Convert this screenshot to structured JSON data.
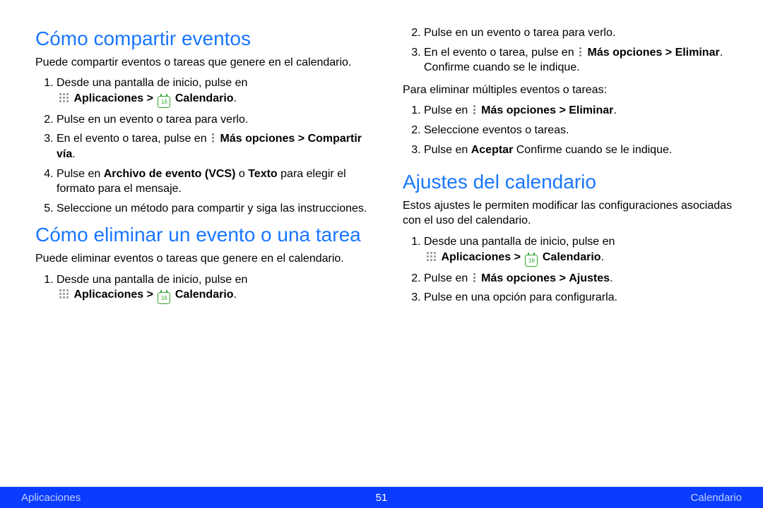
{
  "left": {
    "h1": "Cómo compartir eventos",
    "p1": "Puede compartir eventos o tareas que genere en el calendario.",
    "s1_li1_a": "Desde una pantalla de inicio, pulse en",
    "apps_label": "Aplicaciones",
    "gt": ">",
    "cal_label": "Calendario",
    "cal_day": "16",
    "dot": ".",
    "s1_li2": "Pulse en un evento o tarea para verlo.",
    "s1_li3_a": "En el evento o tarea, pulse en",
    "more_label": "Más opciones",
    "s1_li3_b": "Compartir vía",
    "s1_li4_a": "Pulse en ",
    "s1_li4_b": "Archivo de evento (VCS)",
    "s1_li4_c": " o ",
    "s1_li4_d": "Texto",
    "s1_li4_e": " para elegir el formato para el mensaje.",
    "s1_li5": "Seleccione un método para compartir y siga las instrucciones.",
    "h2": "Cómo eliminar un evento o una tarea",
    "p2": "Puede eliminar eventos o tareas que genere en el calendario.",
    "s2_li1_a": "Desde una pantalla de inicio, pulse en"
  },
  "right": {
    "li2": "Pulse en un evento o tarea para verlo.",
    "li3_a": "En el evento o tarea, pulse en",
    "li3_b": "Eliminar",
    "li3_c": ". Confirme cuando se le indique.",
    "p_multi": "Para eliminar múltiples eventos o tareas:",
    "m_li1_a": "Pulse en",
    "m_li1_b": "Eliminar",
    "m_li2": "Seleccione eventos o tareas.",
    "m_li3_a": "Pulse en ",
    "m_li3_b": "Aceptar",
    "m_li3_c": " Confirme cuando se le indique.",
    "h3": "Ajustes del calendario",
    "p3": "Estos ajustes le permiten modificar las configuraciones asociadas con el uso del calendario.",
    "a_li1_a": "Desde una pantalla de inicio, pulse en",
    "a_li2_a": "Pulse en",
    "a_li2_b": "Ajustes",
    "a_li3": "Pulse en una opción para configurarla."
  },
  "footer": {
    "left": "Aplicaciones",
    "page": "51",
    "right": "Calendario"
  }
}
